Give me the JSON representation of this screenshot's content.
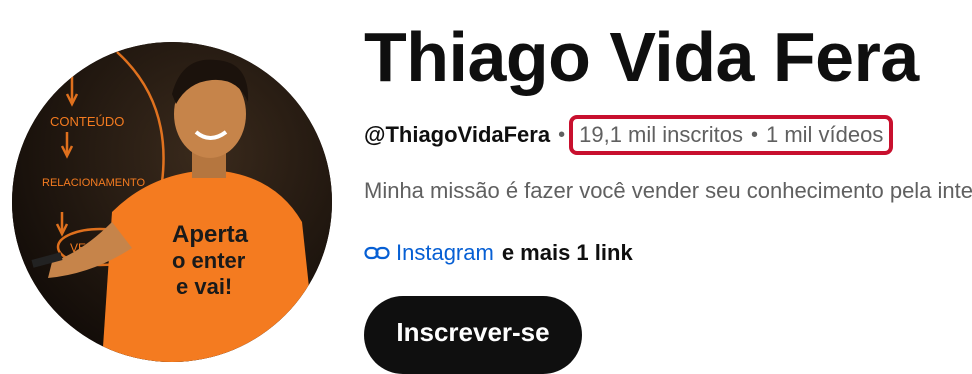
{
  "channel": {
    "name": "Thiago Vida Fera",
    "handle": "@ThiagoVidaFera",
    "subscribers": "19,1 mil inscritos",
    "videos": "1 mil vídeos",
    "separator": "•",
    "description": "Minha missão é fazer você vender seu conhecimento pela internet",
    "link_label": "Instagram",
    "more_links": "e mais 1 link",
    "subscribe_label": "Inscrever-se"
  },
  "avatar_image": {
    "shirt_text": [
      "Aperta",
      "o enter",
      "e vai!"
    ],
    "board_words": [
      "CONTEÚDO",
      "RELACIONAMENTO",
      "VENDAS"
    ]
  },
  "colors": {
    "highlight": "#c8102e",
    "link": "#065fd4",
    "muted": "#606060",
    "button_bg": "#0f0f0f",
    "shirt": "#f47b20"
  }
}
